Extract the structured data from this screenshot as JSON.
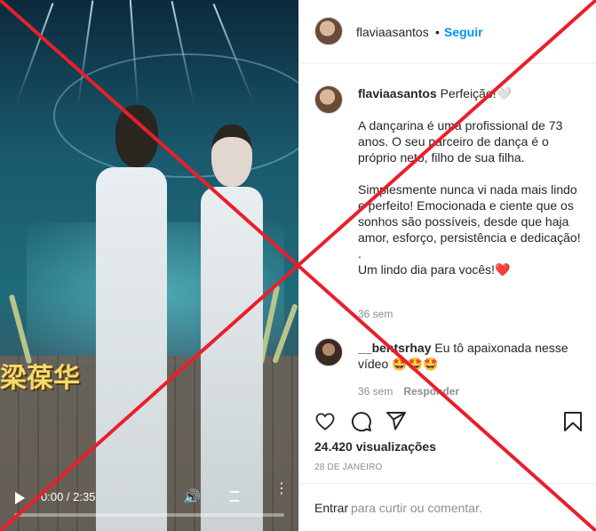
{
  "video": {
    "overlay_text": "梁葆华",
    "time": "0:00 / 2:35"
  },
  "header": {
    "username": "flaviaasantos",
    "separator": "•",
    "follow_label": "Seguir"
  },
  "caption": {
    "username": "flaviaasantos",
    "first_line": "Perfeição!🤍",
    "para1": "A dançarina é uma profissional de 73 anos. O seu parceiro de dança é o próprio neto, filho de sua filha.",
    "para2": "Simplesmente nunca vi nada mais lindo e perfeito! Emocionada e ciente que os sonhos são possíveis, desde que haja amor, esforço, persistência e dedicação!",
    "dot": ".",
    "para3": "Um lindo dia para vocês!❤️",
    "time": "36 sem"
  },
  "comment": {
    "username": "__bentsrhay",
    "text": "Eu tô apaixonada nesse vídeo 🤩🤩🤩",
    "time": "36 sem",
    "reply_label": "Responder"
  },
  "actions": {
    "like_icon": "heart-icon",
    "comment_icon": "comment-icon",
    "share_icon": "share-icon",
    "save_icon": "bookmark-icon"
  },
  "stats": {
    "views_count": "24.420",
    "views_label": "visualizações",
    "date": "28 DE JANEIRO"
  },
  "add_comment": {
    "login_label": "Entrar",
    "rest_label": "para curtir ou comentar."
  },
  "colors": {
    "accent": "#0095f6",
    "cross": "#e8202a",
    "muted": "#8e8e8e"
  }
}
